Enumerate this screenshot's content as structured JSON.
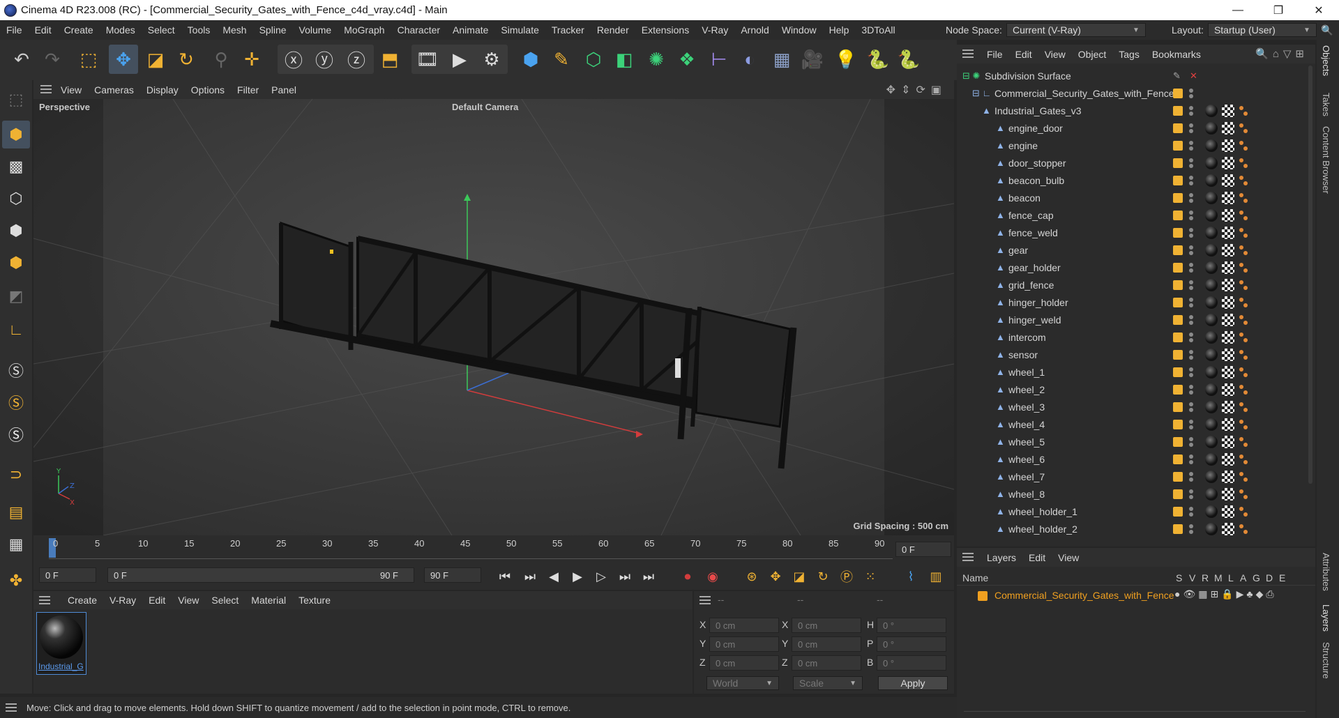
{
  "window": {
    "title": "Cinema 4D R23.008 (RC) - [Commercial_Security_Gates_with_Fence_c4d_vray.c4d] - Main",
    "minimize": "—",
    "restore": "❐",
    "close": "✕"
  },
  "menubar": {
    "items": [
      "File",
      "Edit",
      "Create",
      "Modes",
      "Select",
      "Tools",
      "Mesh",
      "Spline",
      "Volume",
      "MoGraph",
      "Character",
      "Animate",
      "Simulate",
      "Tracker",
      "Render",
      "Extensions",
      "V-Ray",
      "Arnold",
      "Window",
      "Help",
      "3DToAll"
    ],
    "node_space_label": "Node Space:",
    "node_space_value": "Current (V-Ray)",
    "layout_label": "Layout:",
    "layout_value": "Startup (User)"
  },
  "viewport": {
    "menu": [
      "View",
      "Cameras",
      "Display",
      "Options",
      "Filter",
      "Panel"
    ],
    "view_name": "Perspective",
    "camera": "Default Camera",
    "grid_spacing": "Grid Spacing : 500 cm"
  },
  "timeline": {
    "ticks": [
      "0",
      "5",
      "10",
      "15",
      "20",
      "25",
      "30",
      "35",
      "40",
      "45",
      "50",
      "55",
      "60",
      "65",
      "70",
      "75",
      "80",
      "85",
      "90"
    ],
    "current_frame": "0 F"
  },
  "anim": {
    "start": "0 F",
    "range_start": "0 F",
    "range_end": "90 F",
    "end": "90 F"
  },
  "material_panel": {
    "menu": [
      "Create",
      "V-Ray",
      "Edit",
      "View",
      "Select",
      "Material",
      "Texture"
    ],
    "material_name": "Industrial_G"
  },
  "coords": {
    "headers": [
      "--",
      "--",
      "--"
    ],
    "rows": [
      {
        "a": "X",
        "av": "0 cm",
        "b": "X",
        "bv": "0 cm",
        "c": "H",
        "cv": "0 °"
      },
      {
        "a": "Y",
        "av": "0 cm",
        "b": "Y",
        "bv": "0 cm",
        "c": "P",
        "cv": "0 °"
      },
      {
        "a": "Z",
        "av": "0 cm",
        "b": "Z",
        "bv": "0 cm",
        "c": "B",
        "cv": "0 °"
      }
    ],
    "space": "World",
    "mode": "Scale",
    "apply": "Apply"
  },
  "status": "Move: Click and drag to move elements. Hold down SHIFT to quantize movement / add to the selection in point mode, CTRL to remove.",
  "object_manager": {
    "menu": [
      "File",
      "Edit",
      "View",
      "Object",
      "Tags",
      "Bookmarks"
    ],
    "root": "Subdivision Surface",
    "group": "Commercial_Security_Gates_with_Fence",
    "subgroup": "Industrial_Gates_v3",
    "children": [
      "engine_door",
      "engine",
      "door_stopper",
      "beacon_bulb",
      "beacon",
      "fence_cap",
      "fence_weld",
      "gear",
      "gear_holder",
      "grid_fence",
      "hinger_holder",
      "hinger_weld",
      "intercom",
      "sensor",
      "wheel_1",
      "wheel_2",
      "wheel_3",
      "wheel_4",
      "wheel_5",
      "wheel_6",
      "wheel_7",
      "wheel_8",
      "wheel_holder_1",
      "wheel_holder_2"
    ]
  },
  "layer_manager": {
    "menu": [
      "Layers",
      "Edit",
      "View"
    ],
    "col_name": "Name",
    "flags": [
      "S",
      "V",
      "R",
      "M",
      "L",
      "A",
      "G",
      "D",
      "E"
    ],
    "layer_name": "Commercial_Security_Gates_with_Fence",
    "layer_color": "#f0a020"
  },
  "right_tabs": [
    "Objects",
    "Takes",
    "Content Browser",
    "Attributes",
    "Layers",
    "Structure"
  ],
  "colors": {
    "accent_orange": "#f0b233",
    "x_axis": "#d23c3c",
    "y_axis": "#3cc85a",
    "z_axis": "#3c6ed2"
  }
}
